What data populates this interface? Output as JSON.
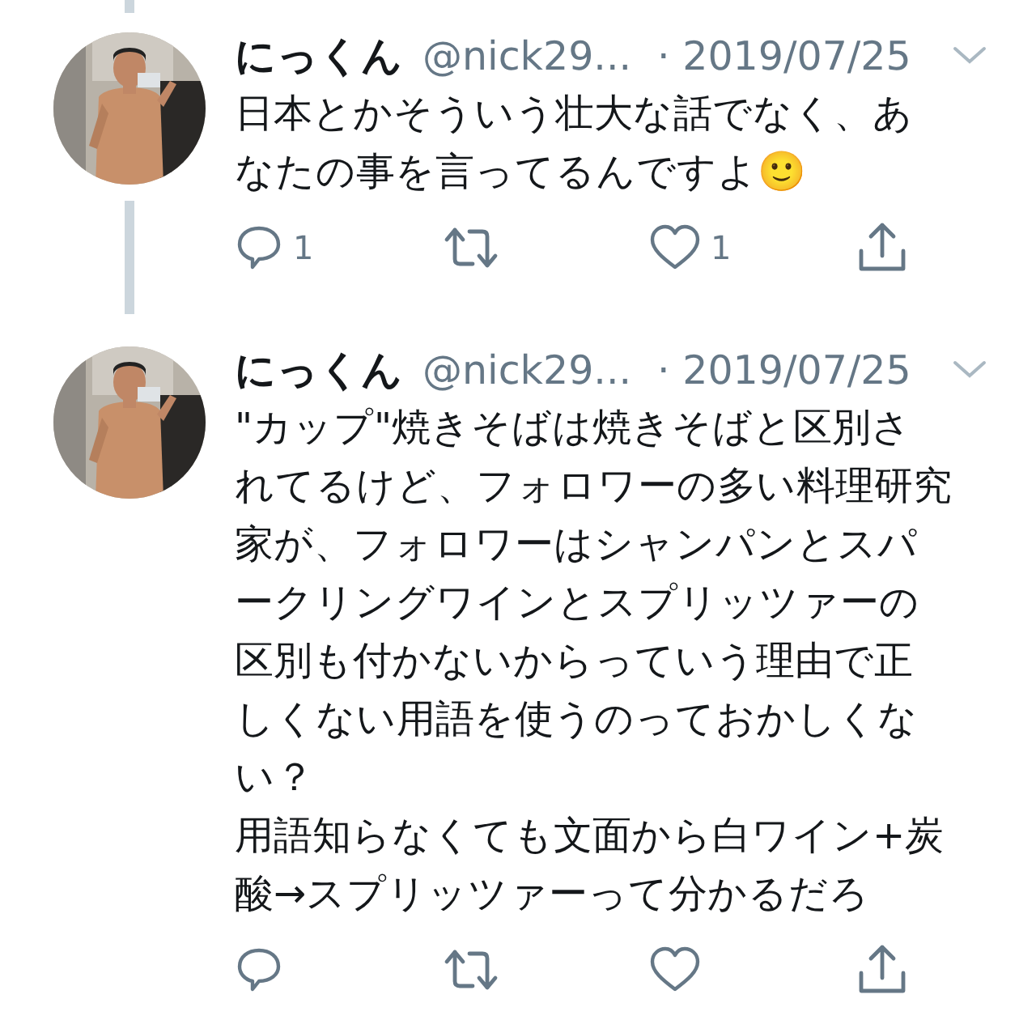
{
  "tweets": [
    {
      "name": "にっくん",
      "handle": "@nick29...",
      "date": "· 2019/07/25",
      "paragraphs": [
        "日本とかそういう壮大な話でなく、あなたの事を言ってるんですよ🙂"
      ],
      "thread_line_above": true,
      "thread_line_below": true,
      "actions": [
        {
          "kind": "reply",
          "count": "1"
        },
        {
          "kind": "retweet"
        },
        {
          "kind": "like",
          "count": "1"
        },
        {
          "kind": "share"
        }
      ]
    },
    {
      "name": "にっくん",
      "handle": "@nick29...",
      "date": "· 2019/07/25",
      "paragraphs": [
        "\"カップ\"焼きそばは焼きそばと区別されてるけど、フォロワーの多い料理研究家が、フォロワーはシャンパンとスパークリングワインとスプリッツァーの区別も付かないからっていう理由で正しくない用語を使うのっておかしくない？",
        "用語知らなくても文面から白ワイン+炭酸→スプリッツァーって分かるだろ"
      ],
      "thread_line_above": false,
      "thread_line_below": false,
      "actions": [
        {
          "kind": "reply"
        },
        {
          "kind": "retweet"
        },
        {
          "kind": "like"
        },
        {
          "kind": "share"
        }
      ]
    }
  ]
}
